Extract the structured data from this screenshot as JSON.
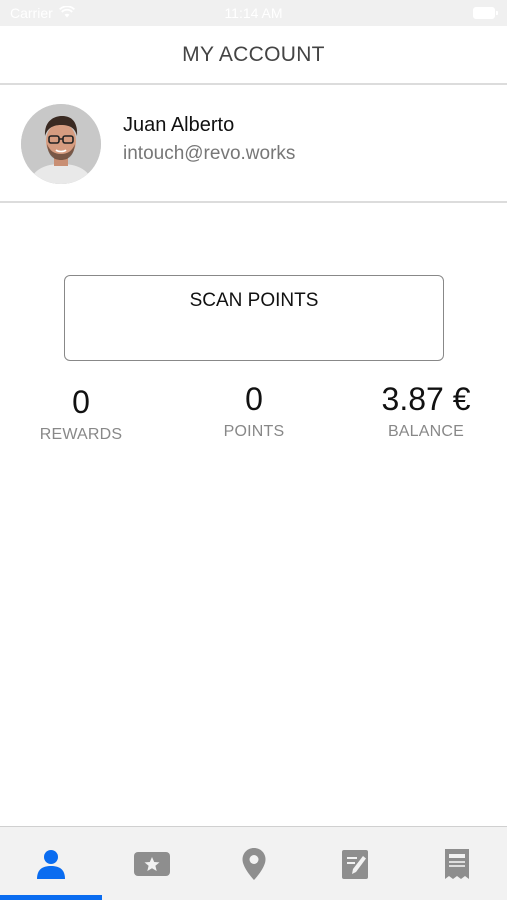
{
  "status_bar": {
    "carrier": "Carrier",
    "time": "11:14 AM",
    "wifi_icon": "wifi-icon",
    "battery_icon": "battery-icon"
  },
  "header": {
    "title": "MY ACCOUNT"
  },
  "profile": {
    "name": "Juan Alberto",
    "email": "intouch@revo.works",
    "avatar_icon": "avatar-photo"
  },
  "scan_button": {
    "label": "SCAN POINTS"
  },
  "stats": {
    "rewards": {
      "value": "0",
      "label": "REWARDS"
    },
    "points": {
      "value": "0",
      "label": "POINTS"
    },
    "balance": {
      "value": "3.87 €",
      "label": "BALANCE"
    }
  },
  "tab_bar": {
    "tabs": [
      {
        "icon": "person-icon",
        "active": true
      },
      {
        "icon": "star-ticket-icon",
        "active": false
      },
      {
        "icon": "map-pin-icon",
        "active": false
      },
      {
        "icon": "note-edit-icon",
        "active": false
      },
      {
        "icon": "receipt-icon",
        "active": false
      }
    ],
    "active_color": "#0a6cf0",
    "inactive_color": "#8e8e8e"
  }
}
